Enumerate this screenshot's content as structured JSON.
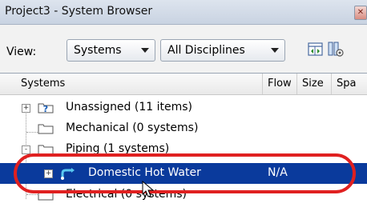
{
  "window": {
    "title": "Project3 - System Browser",
    "close_glyph": "✕"
  },
  "toolbar": {
    "view_label": "View:",
    "systems_select": "Systems",
    "disciplines_select": "All Disciplines",
    "icons": [
      "autofit-columns-icon",
      "column-settings-icon"
    ]
  },
  "columns": [
    "Systems",
    "Flow",
    "Size",
    "Spa"
  ],
  "tree": [
    {
      "label": "Unassigned (11 items)",
      "expander": "+",
      "icon": "unassigned-folder-icon"
    },
    {
      "label": "Mechanical (0 systems)",
      "icon": "folder-icon"
    },
    {
      "label": "Piping (1 systems)",
      "expander": "-",
      "icon": "folder-icon"
    },
    {
      "label": "Domestic Hot Water",
      "expander": "+",
      "icon": "piping-system-icon",
      "flow": "N/A",
      "selected": true
    },
    {
      "label": "Electrical (0 systems)",
      "icon": "folder-icon"
    }
  ],
  "colors": {
    "selection": "#0a3a9c",
    "highlight_oval": "#e02020"
  }
}
